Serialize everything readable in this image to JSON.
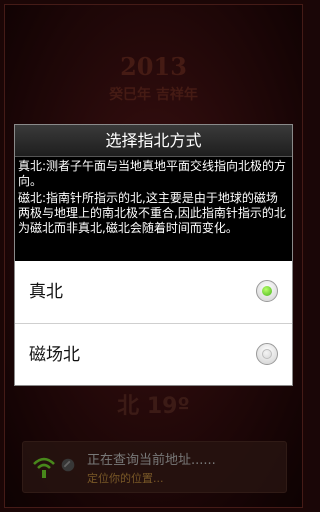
{
  "background": {
    "year": "2013",
    "subtitle": "癸巳年  吉祥年",
    "heading": "北 19º"
  },
  "status": {
    "line1": "正在查询当前地址......",
    "line2": "定位你的位置...",
    "icon": "wifi-signal-icon"
  },
  "dialog": {
    "title": "选择指北方式",
    "desc_true_north": "真北:测者子午面与当地真地平面交线指向北极的方向。",
    "desc_magnetic_north": "磁北:指南针所指示的北,这主要是由于地球的磁场两极与地理上的南北极不重合,因此指南针指示的北为磁北而非真北,磁北会随着时间而变化。",
    "options": [
      {
        "label": "真北",
        "selected": true
      },
      {
        "label": "磁场北",
        "selected": false
      }
    ]
  },
  "colors": {
    "radio_selected": "#46b41a",
    "status_secondary": "#b8863c"
  }
}
